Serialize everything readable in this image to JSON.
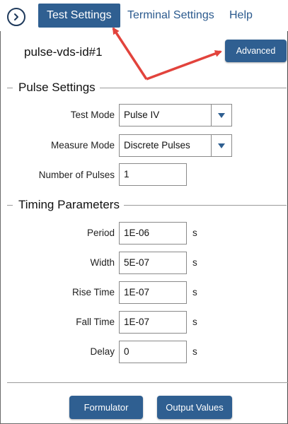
{
  "tabs": [
    {
      "label": "Test Settings",
      "active": true
    },
    {
      "label": "Terminal Settings",
      "active": false
    },
    {
      "label": "Help",
      "active": false
    }
  ],
  "device_name": "pulse-vds-id#1",
  "advanced_label": "Advanced",
  "pulse_settings": {
    "title": "Pulse Settings",
    "test_mode": {
      "label": "Test Mode",
      "value": "Pulse IV"
    },
    "measure_mode": {
      "label": "Measure Mode",
      "value": "Discrete Pulses"
    },
    "num_pulses": {
      "label": "Number of Pulses",
      "value": "1"
    }
  },
  "timing": {
    "title": "Timing Parameters",
    "period": {
      "label": "Period",
      "value": "1E-06",
      "unit": "s"
    },
    "width": {
      "label": "Width",
      "value": "5E-07",
      "unit": "s"
    },
    "rise_time": {
      "label": "Rise Time",
      "value": "1E-07",
      "unit": "s"
    },
    "fall_time": {
      "label": "Fall Time",
      "value": "1E-07",
      "unit": "s"
    },
    "delay": {
      "label": "Delay",
      "value": "0",
      "unit": "s"
    }
  },
  "footer": {
    "formulator_label": "Formulator",
    "output_values_label": "Output Values"
  },
  "colors": {
    "accent": "#2f5f91",
    "annotation_arrow": "#e2433c"
  },
  "icons": {
    "nav": "chevron-right-circle-icon",
    "dropdown": "triangle-down-icon"
  }
}
